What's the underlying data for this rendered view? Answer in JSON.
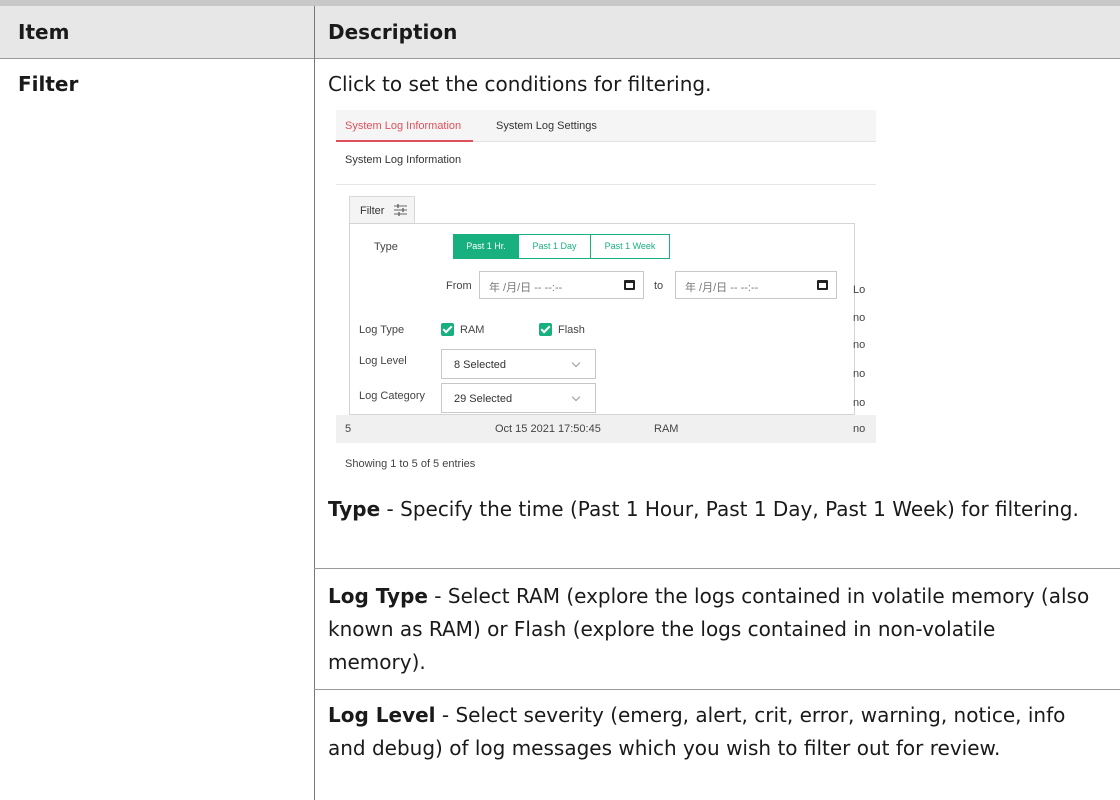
{
  "table": {
    "header_item": "Item",
    "header_description": "Description",
    "row_item": "Filter",
    "row_intro": "Click to set the conditions for filtering."
  },
  "screenshot": {
    "tabs": [
      "System Log Information",
      "System Log Settings"
    ],
    "section_title": "System Log Information",
    "filter_button": "Filter",
    "type_label": "Type",
    "type_options": [
      "Past 1 Hr.",
      "Past 1 Day",
      "Past 1 Week"
    ],
    "from_label": "From",
    "to_label": "to",
    "date_placeholder": "年 /月/日 -- --:--",
    "log_type_label": "Log Type",
    "log_type_options": [
      "RAM",
      "Flash"
    ],
    "log_level_label": "Log Level",
    "log_level_value": "8 Selected",
    "log_category_label": "Log Category",
    "log_category_value": "29 Selected",
    "bg_column_header": "Lo",
    "bg_cells": [
      "no",
      "no",
      "no",
      "no"
    ],
    "row": {
      "num": "5",
      "time": "Oct 15 2021 17:50:45",
      "type": "RAM",
      "msg": "no"
    },
    "entries": "Showing 1 to 5 of 5 entries"
  },
  "descriptions": [
    {
      "term": "Type",
      "text": " - Specify the time (Past 1 Hour, Past 1 Day, Past 1 Week) for filtering."
    },
    {
      "term": "Log Type",
      "text": " - Select RAM (explore the logs contained in volatile memory (also known as RAM) or Flash (explore the logs contained in non-volatile memory)."
    },
    {
      "term": "Log Level",
      "text": " - Select severity (emerg, alert, crit, error, warning, notice, info and debug) of log messages which you wish to filter out for review."
    }
  ],
  "colors": {
    "accent_green": "#18b07f",
    "accent_red": "#e0505b",
    "header_bg": "#e7e7e7"
  },
  "icons": [
    "sliders-icon",
    "calendar-icon",
    "checkbox-checked-icon",
    "chevron-down-icon"
  ]
}
